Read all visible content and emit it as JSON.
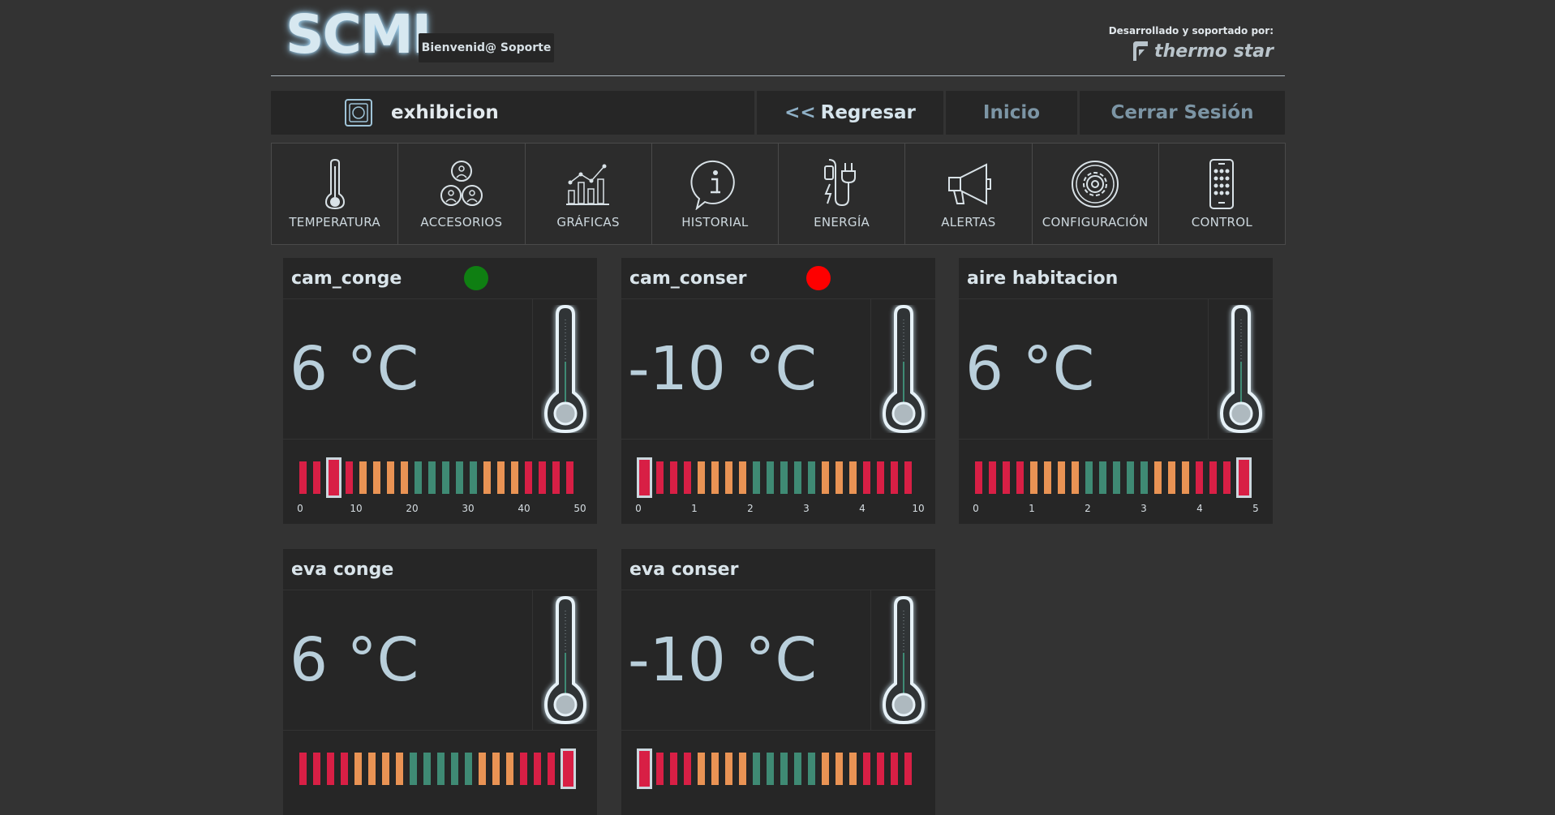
{
  "header": {
    "logo": "SCMI",
    "welcome": "Bienvenid@ Soporte",
    "brand_line": "Desarrollado y soportado por:",
    "brand_name": "thermo star"
  },
  "navbar": {
    "title": "exhibicion",
    "back_label": "Regresar",
    "back_arrows": "<<",
    "home_label": "Inicio",
    "logout_label": "Cerrar Sesión"
  },
  "menu": [
    {
      "label": "TEMPERATURA",
      "icon": "thermometer-icon"
    },
    {
      "label": "ACCESORIOS",
      "icon": "accessories-icon"
    },
    {
      "label": "GRÁFICAS",
      "icon": "chart-icon"
    },
    {
      "label": "HISTORIAL",
      "icon": "info-icon"
    },
    {
      "label": "ENERGÍA",
      "icon": "plug-icon"
    },
    {
      "label": "ALERTAS",
      "icon": "megaphone-icon"
    },
    {
      "label": "CONFIGURACIÓN",
      "icon": "gear-icon"
    },
    {
      "label": "CONTROL",
      "icon": "remote-icon"
    }
  ],
  "colors": {
    "red": "#d81f45",
    "orange": "#e99354",
    "green": "#3f8a74",
    "status_ok": "#0f7f12",
    "status_alarm": "#fe0000"
  },
  "cards": [
    {
      "name": "cam_conge",
      "temp": "6 °C",
      "status": "ok",
      "selected_bar": 2,
      "ticks": [
        "0",
        "10",
        "20",
        "30",
        "40",
        "50"
      ]
    },
    {
      "name": "cam_conser",
      "temp": "-10 °C",
      "status": "alarm",
      "selected_bar": 0,
      "ticks": [
        "0",
        "1",
        "2",
        "3",
        "4",
        "10"
      ]
    },
    {
      "name": "aire habitacion",
      "temp": "6 °C",
      "status": "",
      "selected_bar": 19,
      "ticks": [
        "0",
        "1",
        "2",
        "3",
        "4",
        "5"
      ]
    },
    {
      "name": "eva conge",
      "temp": "6 °C",
      "status": "",
      "selected_bar": 19,
      "ticks": []
    },
    {
      "name": "eva conser",
      "temp": "-10 °C",
      "status": "",
      "selected_bar": 0,
      "ticks": []
    }
  ]
}
